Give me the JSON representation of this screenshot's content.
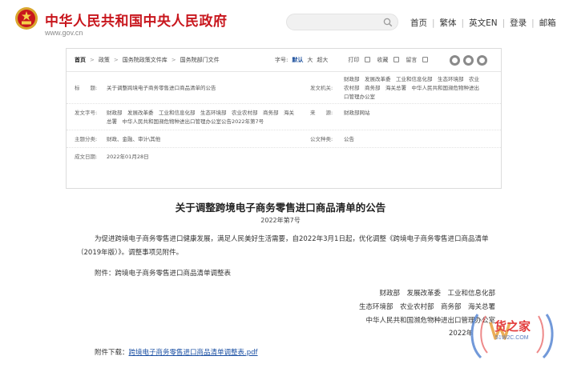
{
  "header": {
    "site_title": "中华人民共和国中央人民政府",
    "site_url": "www.gov.cn",
    "search_placeholder": "",
    "nav": [
      "首页",
      "繁体",
      "英文EN",
      "登录",
      "邮箱"
    ]
  },
  "breadcrumb": [
    "首页",
    "政策",
    "国务院政策文件库",
    "国务院部门文件"
  ],
  "tools": {
    "font_label": "字号:",
    "font_sizes": [
      "默认",
      "大",
      "超大"
    ],
    "active_size": "默认",
    "print": "打印",
    "favorite": "收藏",
    "keep": "留言"
  },
  "meta": {
    "title_label": "标　　题:",
    "title_value": "关于调整跨境电子商务零售进口商品清单的公告",
    "issuer_label": "发文机关:",
    "issuer_value_1": "财政部　发展改革委　工业和信息化部　生态环境部　农业",
    "issuer_value_2": "农村部　商务部　海关总署　中华人民共和国濒危物种进出",
    "issuer_value_3": "口管理办公室",
    "docno_label": "发文字号:",
    "docno_value_1": "财政部　发展改革委　工业和信息化部　生态环境部　农业农村部　商务部　海关",
    "docno_value_2": "总署　中华人民共和国濒危物种进出口管理办公室公告2022年第7号",
    "source_label": "来　　源:",
    "source_value": "财政部网站",
    "subject_label": "主题分类:",
    "subject_value": "财政、金融、审计\\其他",
    "type_label": "公文种类:",
    "type_value": "公告",
    "date_label": "成文日期:",
    "date_value": "2022年01月28日"
  },
  "article": {
    "title": "关于调整跨境电子商务零售进口商品清单的公告",
    "number": "2022年第7号",
    "paragraph": "为促进跨境电子商务零售进口健康发展，满足人民美好生活需要，自2022年3月1日起，优化调整《跨境电子商务零售进口商品清单（2019年版）》。调整事项见附件。",
    "attachment": "附件：跨境电子商务零售进口商品清单调整表",
    "signers": [
      "财政部　发展改革委　工业和信息化部",
      "生态环境部　农业农村部　商务部　海关总署",
      "中华人民共和国濒危物种进出口管理办公室"
    ],
    "date": "2022年",
    "download_label": "附件下载：",
    "download_link": "跨境电子商务零售进口商品清单调整表.pdf"
  },
  "watermark": {
    "text": "货之家",
    "url": "51W2C.COM"
  },
  "colors": {
    "brand_red": "#c8161d",
    "link_blue": "#1a4fa3"
  }
}
